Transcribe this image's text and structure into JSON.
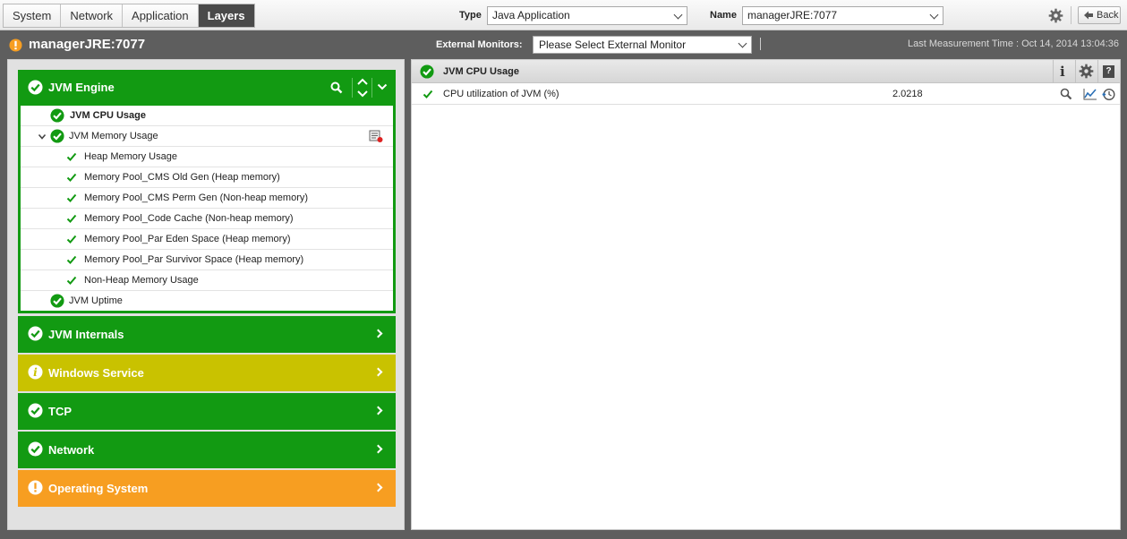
{
  "toolbar": {
    "tabs": [
      {
        "label": "System",
        "active": false
      },
      {
        "label": "Network",
        "active": false
      },
      {
        "label": "Application",
        "active": false
      },
      {
        "label": "Layers",
        "active": true
      }
    ],
    "type_label": "Type",
    "type_value": "Java Application",
    "name_label": "Name",
    "name_value": "managerJRE:7077",
    "back_label": "Back"
  },
  "header": {
    "title": "managerJRE:7077",
    "external_monitors_label": "External Monitors:",
    "external_monitors_value": "Please Select External Monitor",
    "last_measurement": "Last Measurement Time : Oct 14, 2014 13:04:36"
  },
  "layers": {
    "engine": {
      "name": "JVM Engine",
      "status": "ok",
      "tests": [
        {
          "label": "JVM CPU Usage",
          "level": 0,
          "bold": true
        },
        {
          "label": "JVM Memory Usage",
          "level": 0,
          "expanded": true
        },
        {
          "label": "Heap Memory Usage",
          "level": 1
        },
        {
          "label": "Memory Pool_CMS Old Gen (Heap memory)",
          "level": 1
        },
        {
          "label": "Memory Pool_CMS Perm Gen (Non-heap memory)",
          "level": 1
        },
        {
          "label": "Memory Pool_Code Cache (Non-heap memory)",
          "level": 1
        },
        {
          "label": "Memory Pool_Par Eden Space (Heap memory)",
          "level": 1
        },
        {
          "label": "Memory Pool_Par Survivor Space (Heap memory)",
          "level": 1
        },
        {
          "label": "Non-Heap Memory Usage",
          "level": 1
        },
        {
          "label": "JVM Uptime",
          "level": 0
        }
      ]
    },
    "collapsed": [
      {
        "name": "JVM Internals",
        "status": "ok",
        "color": "#129a12"
      },
      {
        "name": "Windows Service",
        "status": "info",
        "color": "#c9c200"
      },
      {
        "name": "TCP",
        "status": "ok",
        "color": "#129a12"
      },
      {
        "name": "Network",
        "status": "ok",
        "color": "#129a12"
      },
      {
        "name": "Operating System",
        "status": "warning",
        "color": "#f79e21"
      }
    ]
  },
  "detail": {
    "title": "JVM CPU Usage",
    "measures": [
      {
        "name": "CPU utilization of JVM (%)",
        "value": "2.0218"
      }
    ]
  }
}
